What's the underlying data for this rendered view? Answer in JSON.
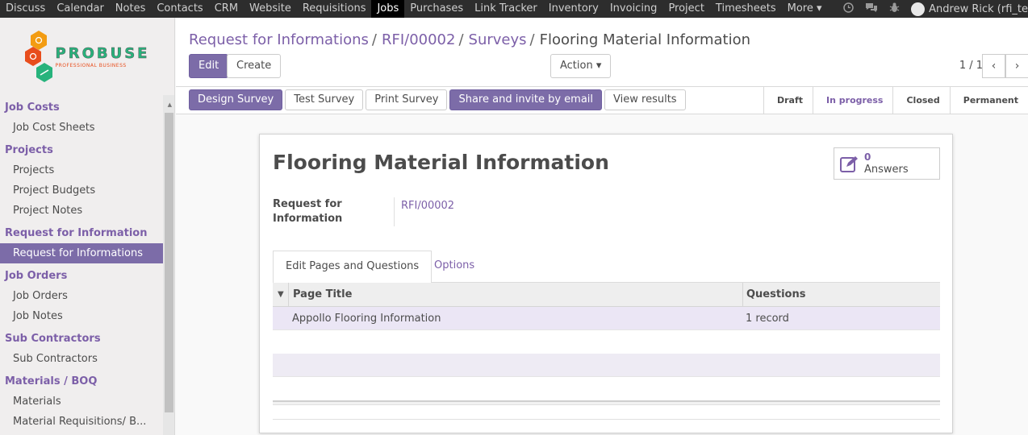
{
  "topnav": {
    "items": [
      "Discuss",
      "Calendar",
      "Notes",
      "Contacts",
      "CRM",
      "Website",
      "Requisitions",
      "Jobs",
      "Purchases",
      "Link Tracker",
      "Inventory",
      "Invoicing",
      "Project",
      "Timesheets",
      "More"
    ],
    "active": "Jobs",
    "more_caret": "▾",
    "user": "Andrew Rick (rfi_te"
  },
  "logo": {
    "name": "PROBUSE",
    "tagline": "PROFESSIONAL BUSINESS"
  },
  "sidebar": {
    "sections": [
      {
        "title": "Job Costs",
        "items": [
          "Job Cost Sheets"
        ]
      },
      {
        "title": "Projects",
        "items": [
          "Projects",
          "Project Budgets",
          "Project Notes"
        ]
      },
      {
        "title": "Request for Information",
        "items": [
          "Request for Informations"
        ]
      },
      {
        "title": "Job Orders",
        "items": [
          "Job Orders",
          "Job Notes"
        ]
      },
      {
        "title": "Sub Contractors",
        "items": [
          "Sub Contractors"
        ]
      },
      {
        "title": "Materials / BOQ",
        "items": [
          "Materials",
          "Material Requisitions/ B..."
        ]
      }
    ],
    "active_item": "Request for Informations"
  },
  "breadcrumb": {
    "items": [
      "Request for Informations",
      "RFI/00002",
      "Surveys"
    ],
    "separator": "/",
    "current": "Flooring Material Information"
  },
  "buttons": {
    "edit": "Edit",
    "create": "Create",
    "action": "Action",
    "action_caret": "▾"
  },
  "pager": {
    "text": "1 / 1",
    "prev": "‹",
    "next": "›"
  },
  "survey_buttons": [
    "Design Survey",
    "Test Survey",
    "Print Survey",
    "Share and invite by email",
    "View results"
  ],
  "stages": [
    "Draft",
    "In progress",
    "Closed",
    "Permanent"
  ],
  "current_stage": "In progress",
  "form": {
    "title": "Flooring Material Information",
    "answers_count": "0",
    "answers_label": "Answers",
    "field_label": "Request for Information",
    "field_value": "RFI/00002"
  },
  "tabs": [
    "Edit Pages and Questions",
    "Options"
  ],
  "table": {
    "headers": [
      "Page Title",
      "Questions"
    ],
    "rows": [
      {
        "title": "Appollo Flooring Information",
        "questions": "1 record"
      }
    ]
  },
  "colors": {
    "primary": "#7c6ca8",
    "link": "#7c5fa8",
    "navbar": "#2d2d2d",
    "logo_green": "#27b37c",
    "logo_orange": "#e84d1c"
  }
}
